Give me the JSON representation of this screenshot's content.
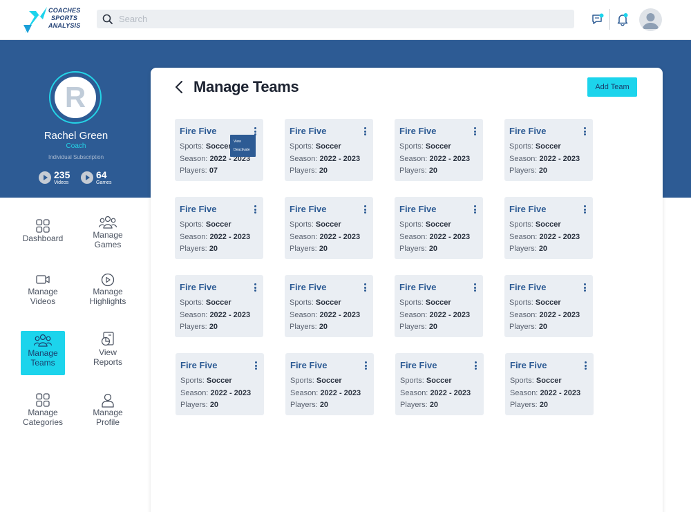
{
  "header": {
    "logo_lines": [
      "COACHES",
      "SPORTS",
      "ANALYSIS"
    ],
    "search_placeholder": "Search"
  },
  "profile": {
    "initial": "R",
    "name": "Rachel Green",
    "role": "Coach",
    "subscription": "Individual Subscription",
    "stats": [
      {
        "value": "235",
        "label": "Videos"
      },
      {
        "value": "64",
        "label": "Games"
      }
    ]
  },
  "nav": [
    {
      "label": "Dashboard",
      "icon": "grid-icon"
    },
    {
      "label": "Manage\nGames",
      "icon": "group-icon"
    },
    {
      "label": "Manage\nVideos",
      "icon": "video-icon"
    },
    {
      "label": "Manage\nHighlights",
      "icon": "play-circle-icon"
    },
    {
      "label": "Manage\nTeams",
      "icon": "group-icon",
      "active": true
    },
    {
      "label": "View\nReports",
      "icon": "report-icon"
    },
    {
      "label": "Manage\nCategories",
      "icon": "grid-icon"
    },
    {
      "label": "Manage\nProfile",
      "icon": "user-icon"
    }
  ],
  "main": {
    "title": "Manage Teams",
    "add_button": "Add Team",
    "field_labels": {
      "sports": "Sports:",
      "season": "Season:",
      "players": "Players:"
    },
    "dropdown": {
      "view": "View",
      "deactivate": "Deactivate"
    },
    "teams": [
      {
        "name": "Fire Five",
        "sport": "Soccer",
        "season": "2022 - 2023",
        "players": "07"
      },
      {
        "name": "Fire Five",
        "sport": "Soccer",
        "season": "2022 - 2023",
        "players": "20"
      },
      {
        "name": "Fire Five",
        "sport": "Soccer",
        "season": "2022 - 2023",
        "players": "20"
      },
      {
        "name": "Fire Five",
        "sport": "Soccer",
        "season": "2022 - 2023",
        "players": "20"
      },
      {
        "name": "Fire Five",
        "sport": "Soccer",
        "season": "2022 - 2023",
        "players": "20"
      },
      {
        "name": "Fire Five",
        "sport": "Soccer",
        "season": "2022 - 2023",
        "players": "20"
      },
      {
        "name": "Fire Five",
        "sport": "Soccer",
        "season": "2022 - 2023",
        "players": "20"
      },
      {
        "name": "Fire Five",
        "sport": "Soccer",
        "season": "2022 - 2023",
        "players": "20"
      },
      {
        "name": "Fire Five",
        "sport": "Soccer",
        "season": "2022 - 2023",
        "players": "20"
      },
      {
        "name": "Fire Five",
        "sport": "Soccer",
        "season": "2022 - 2023",
        "players": "20"
      },
      {
        "name": "Fire Five",
        "sport": "Soccer",
        "season": "2022 - 2023",
        "players": "20"
      },
      {
        "name": "Fire Five",
        "sport": "Soccer",
        "season": "2022 - 2023",
        "players": "20"
      },
      {
        "name": "Fire Five",
        "sport": "Soccer",
        "season": "2022 - 2023",
        "players": "20"
      },
      {
        "name": "Fire Five",
        "sport": "Soccer",
        "season": "2022 - 2023",
        "players": "20"
      },
      {
        "name": "Fire Five",
        "sport": "Soccer",
        "season": "2022 - 2023",
        "players": "20"
      },
      {
        "name": "Fire Five",
        "sport": "Soccer",
        "season": "2022 - 2023",
        "players": "20"
      }
    ]
  },
  "colors": {
    "brand_blue": "#2d5b94",
    "accent_cyan": "#1cd4ec",
    "card_bg": "#eaeef3"
  }
}
